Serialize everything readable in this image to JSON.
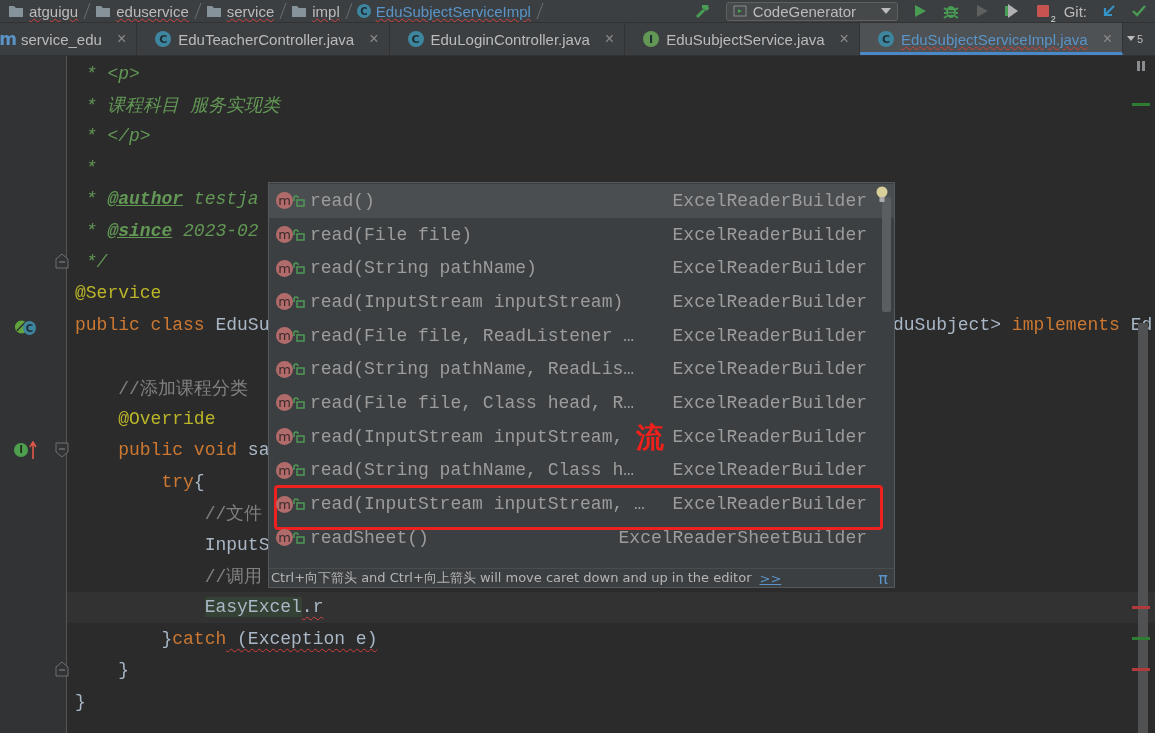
{
  "navbar": {
    "breadcrumbs": [
      {
        "label": "atguigu",
        "kind": "folder",
        "error": true
      },
      {
        "label": "eduservice",
        "kind": "folder",
        "error": true
      },
      {
        "label": "service",
        "kind": "folder",
        "error": true
      },
      {
        "label": "impl",
        "kind": "folder",
        "error": true
      },
      {
        "label": "EduSubjectServiceImpl",
        "kind": "class",
        "icon_letter": "C",
        "error": true
      }
    ],
    "run_config": {
      "label": "CodeGenerator"
    },
    "actions": [
      {
        "kind": "build"
      },
      {
        "kind": "run"
      },
      {
        "kind": "debug"
      },
      {
        "kind": "coverage"
      },
      {
        "kind": "profile"
      },
      {
        "kind": "stop",
        "badge": "2"
      }
    ],
    "vcs": {
      "label": "Git:",
      "actions": [
        {
          "kind": "update"
        },
        {
          "kind": "commit"
        }
      ]
    }
  },
  "tabs": {
    "items": [
      {
        "label": "service_edu",
        "icon_letter": "m",
        "kind": "module",
        "close": "×",
        "selected": false,
        "error": false
      },
      {
        "label": "EduTeacherController.java",
        "icon_letter": "C",
        "kind": "class",
        "close": "×",
        "selected": false,
        "error": false
      },
      {
        "label": "EduLoginController.java",
        "icon_letter": "C",
        "kind": "class",
        "close": "×",
        "selected": false,
        "error": false
      },
      {
        "label": "EduSubjectService.java",
        "icon_letter": "I",
        "kind": "interface",
        "close": "×",
        "selected": false,
        "error": false
      },
      {
        "label": "EduSubjectServiceImpl.java",
        "icon_letter": "C",
        "kind": "class",
        "close": "×",
        "selected": true,
        "error": true
      }
    ],
    "overflow": "5"
  },
  "editor": {
    "lines": [
      {
        "tokens": [
          {
            "text": " * <p>",
            "kind": "doc"
          }
        ]
      },
      {
        "tokens": [
          {
            "text": " * 课程科目 服务实现类",
            "kind": "doc"
          }
        ],
        "stripe": {
          "color": "#2f7d32"
        }
      },
      {
        "tokens": [
          {
            "text": " * </p>",
            "kind": "doc"
          }
        ]
      },
      {
        "tokens": [
          {
            "text": " *",
            "kind": "doc"
          }
        ]
      },
      {
        "tokens": [
          {
            "text": " * ",
            "kind": "doc"
          },
          {
            "text": "@author",
            "kind": "doctag"
          },
          {
            "text": " testja",
            "kind": "doc"
          }
        ]
      },
      {
        "tokens": [
          {
            "text": " * ",
            "kind": "doc"
          },
          {
            "text": "@since",
            "kind": "doctag"
          },
          {
            "text": " 2023-02",
            "kind": "doc"
          }
        ]
      },
      {
        "tokens": [
          {
            "text": " */",
            "kind": "doc"
          }
        ],
        "fold_end": true
      },
      {
        "tokens": [
          {
            "text": "@Service",
            "kind": "annotation"
          }
        ]
      },
      {
        "tokens": [
          {
            "text": "public class",
            "kind": "keyword"
          },
          {
            "text": " EduSu",
            "kind": "plain"
          }
        ],
        "after_popup": [
          {
            "text": "duSubject>",
            "kind": "plain"
          },
          {
            "text": " implements",
            "kind": "keyword"
          },
          {
            "text": " Ed",
            "kind": "plain"
          }
        ],
        "marker": {
          "kind": "bean",
          "letter": "C"
        }
      },
      {
        "tokens": [
          {
            "text": "    //添加课程分类",
            "kind": "comment"
          }
        ],
        "space_before": true
      },
      {
        "tokens": [
          {
            "text": "    @Override",
            "kind": "annotation"
          }
        ]
      },
      {
        "tokens": [
          {
            "text": "    public void",
            "kind": "keyword"
          },
          {
            "text": " sa",
            "kind": "plain"
          }
        ],
        "marker": {
          "kind": "implements",
          "letter": "I"
        },
        "fold_start": true
      },
      {
        "tokens": [
          {
            "text": "        try",
            "kind": "keyword"
          },
          {
            "text": "{",
            "kind": "plain"
          }
        ]
      },
      {
        "tokens": [
          {
            "text": "            //文件",
            "kind": "comment"
          }
        ]
      },
      {
        "tokens": [
          {
            "text": "            InputS",
            "kind": "plain"
          }
        ]
      },
      {
        "tokens": [
          {
            "text": "            //调用",
            "kind": "comment"
          }
        ]
      },
      {
        "tokens": [
          {
            "text": "            EasyExcel",
            "kind": "usage"
          },
          {
            "text": ".r",
            "kind": "plain",
            "error": true
          }
        ],
        "current": true,
        "stripe": {
          "color": "#b33a3a"
        }
      },
      {
        "tokens": [
          {
            "text": "        }",
            "kind": "plain"
          },
          {
            "text": "catch",
            "kind": "keyword"
          },
          {
            "text": " (Exception e)",
            "kind": "plain",
            "error": true
          }
        ],
        "stripe": {
          "color": "#2f7d32"
        }
      },
      {
        "tokens": [
          {
            "text": "    }",
            "kind": "plain"
          }
        ],
        "fold_end": true,
        "stripe": {
          "color": "#b33a3a"
        }
      },
      {
        "tokens": [
          {
            "text": "}",
            "kind": "plain"
          }
        ]
      }
    ],
    "popup": {
      "rows": [
        {
          "icon_letter": "m",
          "name": "read()",
          "type": "ExcelReaderBuilder",
          "selected": true,
          "boxed": false
        },
        {
          "icon_letter": "m",
          "name": "read(File file)",
          "type": "ExcelReaderBuilder",
          "selected": false,
          "boxed": false
        },
        {
          "icon_letter": "m",
          "name": "read(String pathName)",
          "type": "ExcelReaderBuilder",
          "selected": false,
          "boxed": false
        },
        {
          "icon_letter": "m",
          "name": "read(InputStream inputStream)",
          "type": "ExcelReaderBuilder",
          "selected": false,
          "boxed": false
        },
        {
          "icon_letter": "m",
          "name": "read(File file, ReadListener …",
          "type": "ExcelReaderBuilder",
          "selected": false,
          "boxed": false
        },
        {
          "icon_letter": "m",
          "name": "read(String pathName, ReadLis…",
          "type": "ExcelReaderBuilder",
          "selected": false,
          "boxed": false
        },
        {
          "icon_letter": "m",
          "name": "read(File file, Class head, R…",
          "type": "ExcelReaderBuilder",
          "selected": false,
          "boxed": false
        },
        {
          "icon_letter": "m",
          "name": "read(InputStream inputStream,",
          "type": "ExcelReaderBuilder",
          "selected": false,
          "boxed": false
        },
        {
          "icon_letter": "m",
          "name": "read(String pathName, Class h…",
          "type": "ExcelReaderBuilder",
          "selected": false,
          "boxed": false
        },
        {
          "icon_letter": "m",
          "name": "read(InputStream inputStream, …",
          "type": "ExcelReaderBuilder",
          "selected": false,
          "boxed": true
        },
        {
          "icon_letter": "m",
          "name": "readSheet()",
          "type": "ExcelReaderSheetBuilder",
          "selected": false,
          "boxed": false
        }
      ],
      "annotation": "流",
      "hint": "Ctrl+向下箭头 and Ctrl+向上箭头 will move caret down and up in the editor",
      "hint_link": ">>",
      "corner": "π"
    }
  }
}
